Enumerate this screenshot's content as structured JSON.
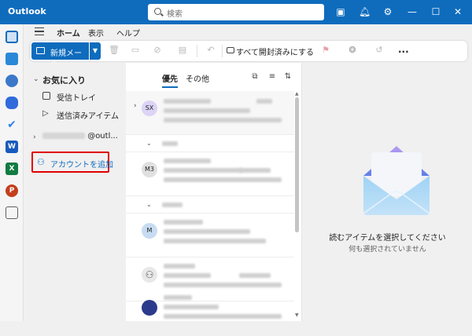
{
  "titlebar": {
    "app_title": "Outlook",
    "search_placeholder": "検索"
  },
  "ribbon": {
    "tabs": [
      "ホーム",
      "表示",
      "ヘルプ"
    ],
    "active_tab": "ホーム",
    "new_mail_label": "新規メール",
    "mark_all_read_label": "すべて開封済みにする",
    "more_label": "..."
  },
  "folders": {
    "favorites_label": "お気に入り",
    "items": [
      {
        "label": "受信トレイ",
        "icon": "inbox-icon"
      },
      {
        "label": "送信済みアイテム",
        "icon": "send-icon"
      }
    ],
    "account_suffix": "@outl...",
    "add_account_label": "アカウントを追加"
  },
  "message_list": {
    "tabs": [
      "優先",
      "その他"
    ],
    "active_tab": "優先",
    "messages": [
      {
        "avatar": "SX",
        "avatar_color": "#dcd3f5"
      },
      {
        "avatar": "M3",
        "avatar_color": "#e0e0e0"
      },
      {
        "avatar": "M",
        "avatar_color": "#c7dcf2"
      },
      {
        "avatar": "",
        "avatar_color": "#e8e8e8"
      },
      {
        "avatar": "",
        "avatar_color": "#2b3a8c"
      }
    ]
  },
  "reading_pane": {
    "empty_title": "読むアイテムを選択してください",
    "empty_subtitle": "何も選択されていません"
  },
  "colors": {
    "accent": "#0f6cbd",
    "highlight_border": "#e00000"
  }
}
